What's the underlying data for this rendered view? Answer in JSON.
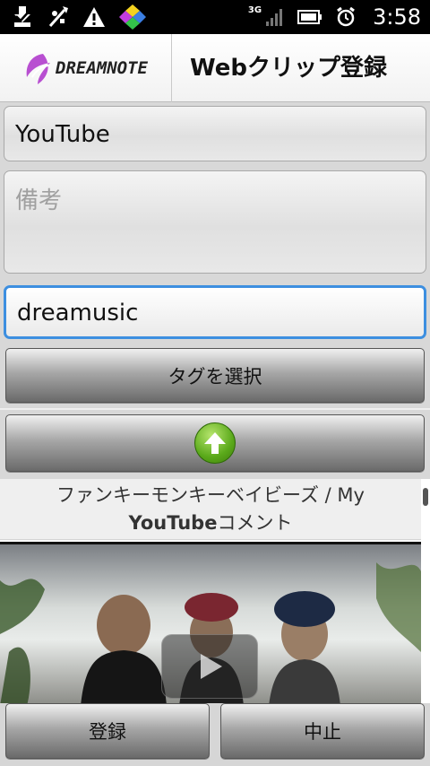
{
  "status_bar": {
    "network": "3G",
    "time": "3:58",
    "icons": [
      "download-icon",
      "usb-icon",
      "warning-icon",
      "app-icon",
      "signal-icon",
      "battery-icon",
      "alarm-icon"
    ]
  },
  "header": {
    "logo": "DREAMNOTE",
    "title": "Webクリップ登録"
  },
  "form": {
    "title_value": "YouTube",
    "memo_placeholder": "備考",
    "tags_value": "dreamusic",
    "select_tag_label": "タグを選択",
    "scroll_up_icon": "up-arrow-icon"
  },
  "preview": {
    "title_line1": "ファンキーモンキーベイビーズ / My",
    "title_line2_bold": "YouTube",
    "title_line2_rest": "コメント",
    "video_icon": "play-icon"
  },
  "actions": {
    "register_label": "登録",
    "cancel_label": "中止"
  },
  "colors": {
    "focus_border": "#3d8fe0",
    "status_bar_bg": "#000000",
    "up_button_green": "#5aa91a"
  }
}
